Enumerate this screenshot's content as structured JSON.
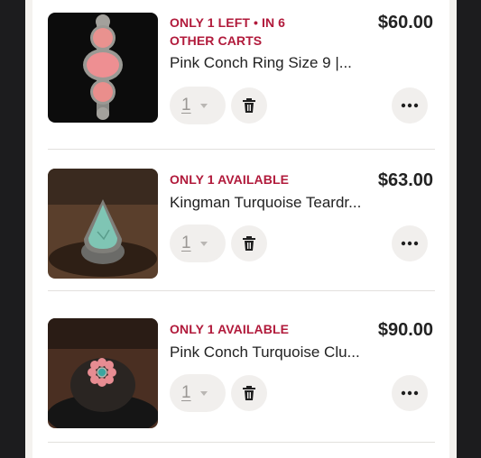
{
  "cart": {
    "items": [
      {
        "badge": "Only 1 left • in 6 other carts",
        "title": "Pink Conch Ring Size 9 |...",
        "price": "$60.00",
        "quantity": "1",
        "image_icon": "pink-conch-ring-photo"
      },
      {
        "badge": "Only 1 available",
        "title": "Kingman Turquoise Teardr...",
        "price": "$63.00",
        "quantity": "1",
        "image_icon": "turquoise-teardrop-ring-photo"
      },
      {
        "badge": "Only 1 available",
        "title": "Pink Conch Turquoise Clu...",
        "price": "$90.00",
        "quantity": "1",
        "image_icon": "pink-cluster-ring-photo"
      }
    ]
  },
  "colors": {
    "badge": "#b11a3b",
    "button_bg": "#f1efed",
    "page_bg": "#1c1c1e"
  }
}
